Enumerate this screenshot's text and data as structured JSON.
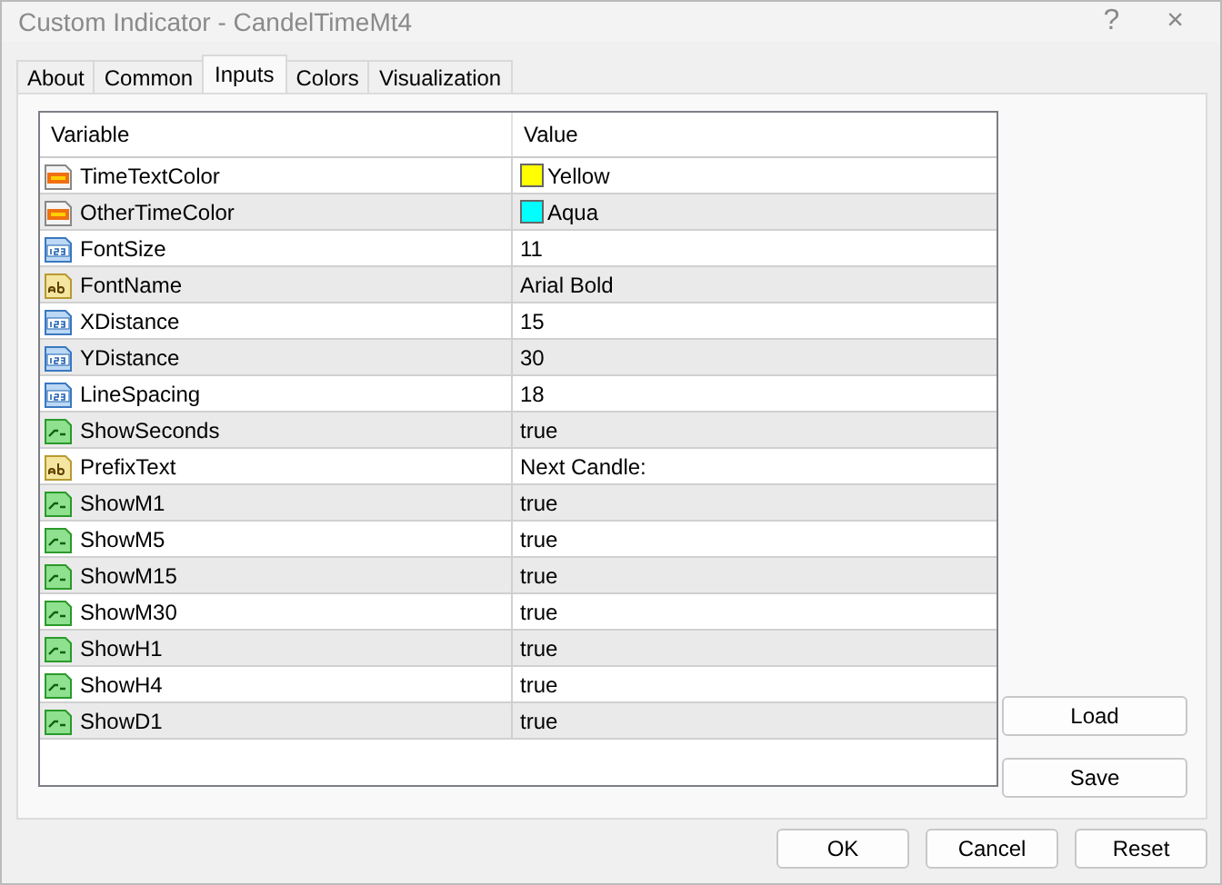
{
  "window": {
    "title": "Custom Indicator - CandelTimeMt4",
    "buttons": [
      "?",
      "×"
    ]
  },
  "tabs": [
    {
      "label": "About",
      "selected": false
    },
    {
      "label": "Common",
      "selected": false
    },
    {
      "label": "Inputs",
      "selected": true
    },
    {
      "label": "Colors",
      "selected": false
    },
    {
      "label": "Visualization",
      "selected": false
    }
  ],
  "table": {
    "columns": [
      "Variable",
      "Value"
    ],
    "rows": [
      {
        "kind": "color",
        "variable": "TimeTextColor",
        "value": "Yellow",
        "color": "#ffff00"
      },
      {
        "kind": "color",
        "variable": "OtherTimeColor",
        "value": "Aqua",
        "color": "#00ffff"
      },
      {
        "kind": "number",
        "variable": "FontSize",
        "value": "11"
      },
      {
        "kind": "text",
        "variable": "FontName",
        "value": "Arial Bold"
      },
      {
        "kind": "number",
        "variable": "XDistance",
        "value": "15"
      },
      {
        "kind": "number",
        "variable": "YDistance",
        "value": "30"
      },
      {
        "kind": "number",
        "variable": "LineSpacing",
        "value": "18"
      },
      {
        "kind": "bool",
        "variable": "ShowSeconds",
        "value": "true"
      },
      {
        "kind": "text",
        "variable": "PrefixText",
        "value": "Next Candle:"
      },
      {
        "kind": "bool",
        "variable": "ShowM1",
        "value": "true"
      },
      {
        "kind": "bool",
        "variable": "ShowM5",
        "value": "true"
      },
      {
        "kind": "bool",
        "variable": "ShowM15",
        "value": "true"
      },
      {
        "kind": "bool",
        "variable": "ShowM30",
        "value": "true"
      },
      {
        "kind": "bool",
        "variable": "ShowH1",
        "value": "true"
      },
      {
        "kind": "bool",
        "variable": "ShowH4",
        "value": "true"
      },
      {
        "kind": "bool",
        "variable": "ShowD1",
        "value": "true"
      }
    ]
  },
  "side_buttons": [
    "Load",
    "Save"
  ],
  "footer_buttons": [
    "OK",
    "Cancel",
    "Reset"
  ]
}
